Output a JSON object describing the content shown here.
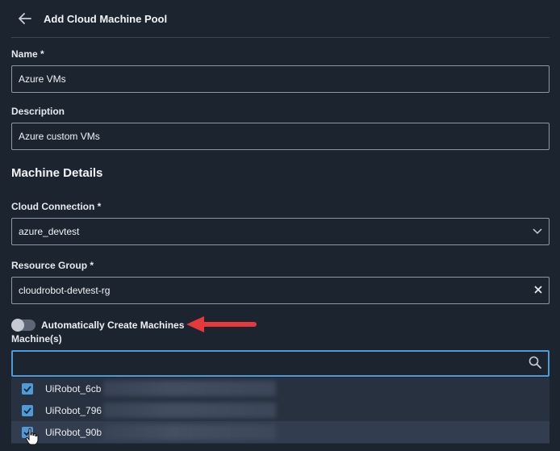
{
  "header": {
    "title": "Add Cloud Machine Pool"
  },
  "name": {
    "label": "Name *",
    "value": "Azure VMs"
  },
  "description": {
    "label": "Description",
    "value": "Azure custom VMs"
  },
  "machine_details": {
    "title": "Machine Details"
  },
  "cloud_connection": {
    "label": "Cloud Connection *",
    "value": "azure_devtest"
  },
  "resource_group": {
    "label": "Resource Group *",
    "value": "cloudrobot-devtest-rg"
  },
  "auto_create": {
    "label": "Automatically Create Machines",
    "enabled": false
  },
  "machines": {
    "label": "Machine(s)",
    "search_value": "",
    "options": [
      {
        "label": "UiRobot_6cb",
        "checked": true
      },
      {
        "label": "UiRobot_796",
        "checked": true
      },
      {
        "label": "UiRobot_90b",
        "checked": true
      }
    ]
  },
  "colors": {
    "background": "#1c2430",
    "accent": "#4f9bd9",
    "arrow": "#e5393c"
  },
  "icons": [
    "back-arrow-icon",
    "chevron-down-icon",
    "close-icon",
    "search-icon",
    "checkmark-icon",
    "hand-cursor-icon",
    "red-arrow-annotation"
  ]
}
